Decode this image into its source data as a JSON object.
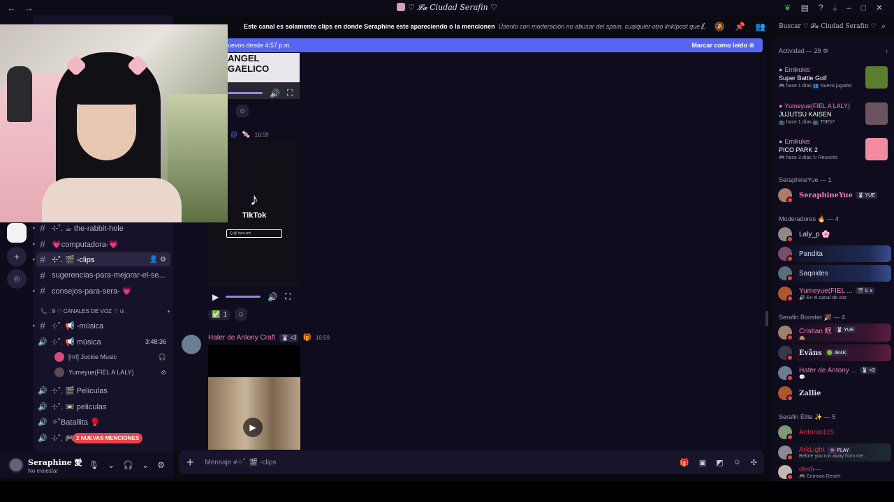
{
  "titlebar": {
    "back": "←",
    "forward": "→",
    "server_name": "♡ 𝓛𝓪 Ciudad Serafin ♡",
    "minimize": "–",
    "maximize": "□",
    "close": "✕"
  },
  "header": {
    "channel_name": "Este canal es solamente clips en donde Seraphine este apareciendo o la mencionen",
    "topic": "Úsenlo con moderación no abusar del spam, cualquier otro link/post que ..."
  },
  "search": {
    "placeholder": "Buscar ♡ 𝓛𝓪 Ciudad Serafin ♡"
  },
  "newbar": {
    "text": "uevos desde 4:57 p.m.",
    "mark_read": "Marcar como leído"
  },
  "channels": [
    {
      "label": "⊹˚. ☕ the-rabbit-hole",
      "arrow": "▸"
    },
    {
      "label": "💗computadora-💗",
      "arrow": "▸"
    },
    {
      "label": "⊹˚. 🎬 -clips",
      "arrow": "▸",
      "active": true
    },
    {
      "label": "sugerencias-para-mejorar-el-se...",
      "arrow": ""
    },
    {
      "label": "consejos-para-sera- 💗",
      "arrow": "▸"
    }
  ],
  "voice_category": {
    "label": "📞 . 9 ♡ CANALES DE VOZ ♡ ଓ .",
    "add": "+"
  },
  "voice": {
    "musica_text": {
      "label": "⊹˚. 📢 -música"
    },
    "musica_voice": {
      "label": "⊹˚. 📢 música",
      "time": "3:48:36"
    },
    "users": [
      {
        "name": "[m!] Jockie Music"
      },
      {
        "name": "Yumeyue(FIEL A LALY)"
      }
    ],
    "others": [
      {
        "label": "⊹˚. 🎬 Peliculas"
      },
      {
        "label": "⊹˚. 📼 peliculas"
      },
      {
        "label": "✧˚Batallita 🥊"
      },
      {
        "label": "⊹˚. 🎮"
      }
    ],
    "mentions": "2 NUEVAS MENCIONES"
  },
  "userpanel": {
    "name": "Seraphine 愛",
    "status": "No molestar"
  },
  "chat": {
    "partial_text": "ANGEL GAELICO",
    "msg1_time": "16:59",
    "reaction1_emoji": "✅",
    "reaction1_count": "1",
    "tiktok_label": "TikTok",
    "tiktok_search": "Q  @ fava.sml",
    "msg2": {
      "author": "Hater de Antony Craft",
      "badge": "🐰 <3",
      "time": "16:59"
    }
  },
  "composer": {
    "placeholder": "Mensaje #⊹˚. 🎬 -clips"
  },
  "members": {
    "activity_header": "Actividad — 29 ⚙",
    "activities": [
      {
        "user": "Emikukis",
        "game": "Super Battle Golf",
        "detail": "🎮 hace 1 días  👥 Nuevo jugador",
        "color": "#d9c24a"
      },
      {
        "user": "Yumeyue(FIEL A LALY)",
        "game": "JUJUTSU KAISEN",
        "detail": "📺 hace 1 días  📺 T5E57",
        "color": "#6b5460"
      },
      {
        "user": "Emikukis",
        "game": "PICO PARK 2",
        "detail": "🎮 hace 3 días  ↻ Resucitó",
        "color": "#f28aa0"
      }
    ],
    "sections": [
      {
        "title": "SeraphineYue — 1"
      },
      {
        "title": "Moderadores 🔥 — 4"
      },
      {
        "title": "Serafin Booster 🎉 — 4"
      },
      {
        "title": "Serafin Élite ✨ — 5"
      }
    ],
    "list": [
      {
        "name": "SeraphineYue",
        "tag": "🐰 YUE",
        "sub": "",
        "color": "#f07fb9"
      },
      {
        "name": "Laly_p 🌸",
        "tag": "",
        "sub": "",
        "color": "#e6e6f0"
      },
      {
        "name": "Pandita",
        "tag": "",
        "sub": "",
        "color": "#e6e6f0"
      },
      {
        "name": "Saqoides",
        "tag": "",
        "sub": "",
        "color": "#e6e6f0"
      },
      {
        "name": "Yumeyue(FIEL ...",
        "tag": "🎬 C x",
        "sub": "🔊 En el canal de voz",
        "color": "#f07fb9"
      },
      {
        "name": "Cristian 眠",
        "tag": "🐰 YUE",
        "sub": "🙈",
        "color": "#f07fb9"
      },
      {
        "name": "Evãns",
        "tag": "🟢 4K4K",
        "sub": "",
        "color": "#ffffff"
      },
      {
        "name": "Hater de Antony ...",
        "tag": "🐰 <3",
        "sub": "💬",
        "color": "#f07fb9"
      },
      {
        "name": "Zallie",
        "tag": "",
        "sub": "",
        "color": "#ffffff"
      },
      {
        "name": "Antonio115",
        "tag": "",
        "sub": "",
        "color": "#d6334d"
      },
      {
        "name": "ArkLight",
        "tag": "👾 PLAY",
        "sub": "Before you run away from me...",
        "color": "#d6334d"
      },
      {
        "name": "dosh—",
        "tag": "",
        "sub": "🎮 Crimson Desert",
        "color": "#d6334d"
      }
    ]
  }
}
